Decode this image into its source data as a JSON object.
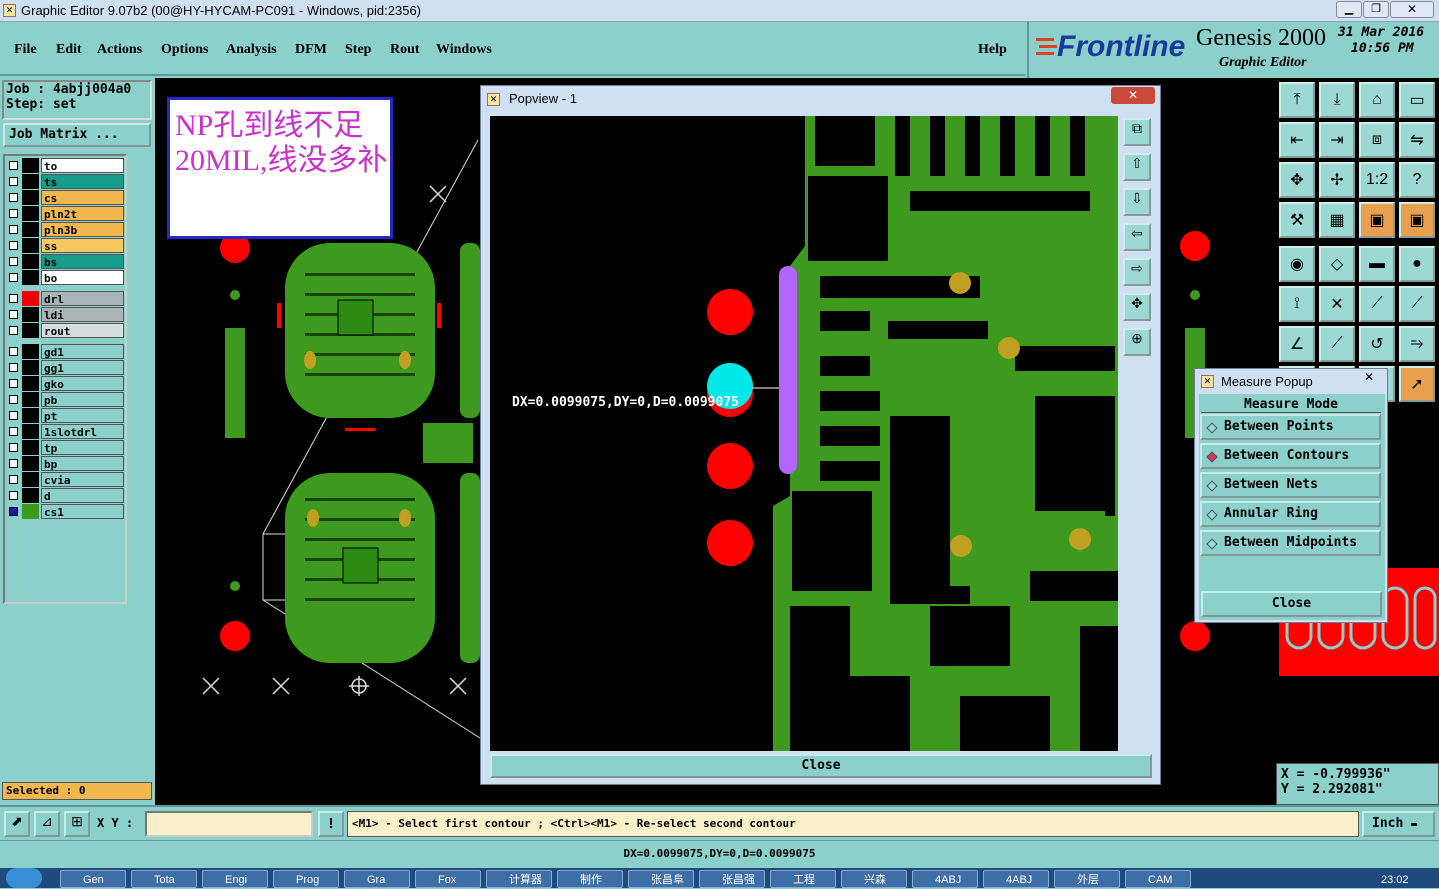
{
  "window": {
    "title": "Graphic Editor 9.07b2 (00@HY-HYCAM-PC091 - Windows, pid:2356)"
  },
  "menu": {
    "items": [
      "File",
      "Edit",
      "Actions",
      "Options",
      "Analysis",
      "DFM",
      "Step",
      "Rout",
      "Windows"
    ],
    "help": "Help"
  },
  "brand": {
    "logo": "Frontline",
    "product": "Genesis 2000",
    "subtitle": "Graphic Editor",
    "date": "31 Mar 2016",
    "time": "10:56 PM"
  },
  "job": {
    "job_label": "Job : 4abjj004a0",
    "step_label": "Step: set",
    "matrix_button": "Job Matrix ..."
  },
  "note": {
    "text": "NP孔到线不足20MIL,线没多补"
  },
  "layers": [
    {
      "name": "to",
      "color": "#ffffff"
    },
    {
      "name": "ts",
      "color": "#169c88"
    },
    {
      "name": "cs",
      "color": "#f0b84c"
    },
    {
      "name": "pln2t",
      "color": "#f0b84c"
    },
    {
      "name": "pln3b",
      "color": "#f0b84c"
    },
    {
      "name": "ss",
      "color": "#f8c860"
    },
    {
      "name": "bs",
      "color": "#169c88"
    },
    {
      "name": "bo",
      "color": "#ffffff"
    },
    {
      "name": "drl",
      "color": "#a8b4b8"
    },
    {
      "name": "ldi",
      "color": "#a8b4b8"
    },
    {
      "name": "rout",
      "color": "#d8dcdc"
    },
    {
      "name": "gd1",
      "color": "#8cd0cc"
    },
    {
      "name": "gg1",
      "color": "#8cd0cc"
    },
    {
      "name": "gko",
      "color": "#8cd0cc"
    },
    {
      "name": "pb",
      "color": "#8cd0cc"
    },
    {
      "name": "pt",
      "color": "#8cd0cc"
    },
    {
      "name": "1slotdrl",
      "color": "#8cd0cc"
    },
    {
      "name": "tp",
      "color": "#8cd0cc"
    },
    {
      "name": "bp",
      "color": "#8cd0cc"
    },
    {
      "name": "cvia",
      "color": "#8cd0cc"
    },
    {
      "name": "d",
      "color": "#8cd0cc"
    },
    {
      "name": "cs1",
      "color": "#8cd0cc"
    }
  ],
  "selected": {
    "label": "Selected : 0"
  },
  "popview": {
    "title": "Popview - 1",
    "measure_text": "DX=0.0099075,DY=0,D=0.0099075",
    "close_label": "Close"
  },
  "measure_popup": {
    "title": "Measure Popup",
    "header": "Measure Mode",
    "options": [
      "Between Points",
      "Between Contours",
      "Between Nets",
      "Annular Ring",
      "Between Midpoints"
    ],
    "selected": "Between Contours",
    "close_label": "Close"
  },
  "coords": {
    "x": "X = -0.799936\"",
    "y": "Y = 2.292081\""
  },
  "statusbar": {
    "xy_label": "X Y :",
    "xy_value": "",
    "prompt": "<M1> - Select first contour ; <Ctrl><M1> - Re-select second contour",
    "units": "Inch",
    "result": "DX=0.0099075,DY=0,D=0.0099075"
  },
  "taskbar": {
    "items": [
      "Gen",
      "Tota",
      "Engi",
      "Prog",
      "Gra",
      "Fox",
      "计算器",
      "制作",
      "张昌阜",
      "张昌强",
      "工程",
      "兴森",
      "4ABJ",
      "4ABJ",
      "外层",
      "CAM"
    ],
    "clock": "23:02"
  },
  "colors": {
    "copper": "#3d9a1e",
    "pad": "#ff0000",
    "highlight": "#00e8e8",
    "line": "#b266ff",
    "bg": "#8cd0cc"
  }
}
